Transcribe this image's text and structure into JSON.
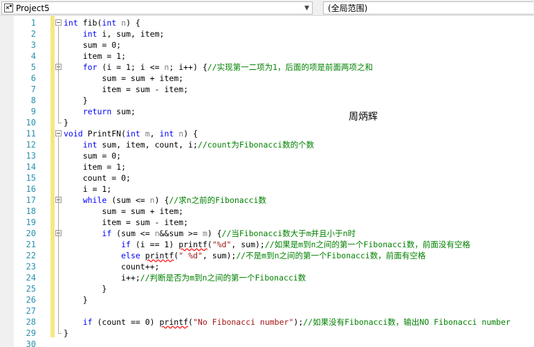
{
  "navbar": {
    "project": "Project5",
    "scope": "(全局范围)"
  },
  "author_name": "周炳辉",
  "editor": {
    "lines": [
      {
        "n": "1",
        "fold": true,
        "spans": [
          {
            "t": "int",
            "c": "kw"
          },
          {
            "t": " fib("
          },
          {
            "t": "int",
            "c": "kw"
          },
          {
            "t": " "
          },
          {
            "t": "n",
            "c": "pm"
          },
          {
            "t": ") {"
          }
        ]
      },
      {
        "n": "2",
        "spans": [
          {
            "t": "    "
          },
          {
            "t": "int",
            "c": "kw"
          },
          {
            "t": " i, sum, item;"
          }
        ]
      },
      {
        "n": "3",
        "spans": [
          {
            "t": "    sum = 0;"
          }
        ]
      },
      {
        "n": "4",
        "spans": [
          {
            "t": "    item = 1;"
          }
        ]
      },
      {
        "n": "5",
        "fold": true,
        "spans": [
          {
            "t": "    "
          },
          {
            "t": "for",
            "c": "kw"
          },
          {
            "t": " (i = 1; i <= "
          },
          {
            "t": "n",
            "c": "pm"
          },
          {
            "t": "; i++) {"
          },
          {
            "t": "//实现第一二项为1，后面的项是前面两项之和",
            "c": "cm"
          }
        ]
      },
      {
        "n": "6",
        "spans": [
          {
            "t": "        sum = sum + item;"
          }
        ]
      },
      {
        "n": "7",
        "spans": [
          {
            "t": "        item = sum - item;"
          }
        ]
      },
      {
        "n": "8",
        "spans": [
          {
            "t": "    }"
          }
        ]
      },
      {
        "n": "9",
        "spans": [
          {
            "t": "    "
          },
          {
            "t": "return",
            "c": "kw"
          },
          {
            "t": " sum;"
          }
        ]
      },
      {
        "n": "10",
        "spans": [
          {
            "t": "}"
          }
        ]
      },
      {
        "n": "11",
        "fold": true,
        "spans": [
          {
            "t": "void",
            "c": "kw"
          },
          {
            "t": " PrintFN("
          },
          {
            "t": "int",
            "c": "kw"
          },
          {
            "t": " "
          },
          {
            "t": "m",
            "c": "pm"
          },
          {
            "t": ", "
          },
          {
            "t": "int",
            "c": "kw"
          },
          {
            "t": " "
          },
          {
            "t": "n",
            "c": "pm"
          },
          {
            "t": ") {"
          }
        ]
      },
      {
        "n": "12",
        "spans": [
          {
            "t": "    "
          },
          {
            "t": "int",
            "c": "kw"
          },
          {
            "t": " sum, item, count, i;"
          },
          {
            "t": "//count为Fibonacci数的个数",
            "c": "cm"
          }
        ]
      },
      {
        "n": "13",
        "spans": [
          {
            "t": "    sum = 0;"
          }
        ]
      },
      {
        "n": "14",
        "spans": [
          {
            "t": "    item = 1;"
          }
        ]
      },
      {
        "n": "15",
        "spans": [
          {
            "t": "    count = 0;"
          }
        ]
      },
      {
        "n": "16",
        "spans": [
          {
            "t": "    i = 1;"
          }
        ]
      },
      {
        "n": "17",
        "fold": true,
        "spans": [
          {
            "t": "    "
          },
          {
            "t": "while",
            "c": "kw"
          },
          {
            "t": " (sum <= "
          },
          {
            "t": "n",
            "c": "pm"
          },
          {
            "t": ") {"
          },
          {
            "t": "//求n之前的Fibonacci数",
            "c": "cm"
          }
        ]
      },
      {
        "n": "18",
        "spans": [
          {
            "t": "        sum = sum + item;"
          }
        ]
      },
      {
        "n": "19",
        "spans": [
          {
            "t": "        item = sum - item;"
          }
        ]
      },
      {
        "n": "20",
        "fold": true,
        "spans": [
          {
            "t": "        "
          },
          {
            "t": "if",
            "c": "kw"
          },
          {
            "t": " (sum <= "
          },
          {
            "t": "n",
            "c": "pm"
          },
          {
            "t": "&&sum >= "
          },
          {
            "t": "m",
            "c": "pm"
          },
          {
            "t": ") {"
          },
          {
            "t": "//当Fibonacci数大于m并且小于n时",
            "c": "cm"
          }
        ]
      },
      {
        "n": "21",
        "spans": [
          {
            "t": "            "
          },
          {
            "t": "if",
            "c": "kw"
          },
          {
            "t": " (i == 1) "
          },
          {
            "t": "printf",
            "c": "err"
          },
          {
            "t": "("
          },
          {
            "t": "\"%d\"",
            "c": "st"
          },
          {
            "t": ", sum);"
          },
          {
            "t": "//如果是m到n之间的第一个Fibonacci数，前面没有空格",
            "c": "cm"
          }
        ]
      },
      {
        "n": "22",
        "spans": [
          {
            "t": "            "
          },
          {
            "t": "else",
            "c": "kw"
          },
          {
            "t": " "
          },
          {
            "t": "printf",
            "c": "err"
          },
          {
            "t": "("
          },
          {
            "t": "\" %d\"",
            "c": "st"
          },
          {
            "t": ", sum);"
          },
          {
            "t": "//不是m到n之间的第一个Fibonacci数，前面有空格",
            "c": "cm"
          }
        ]
      },
      {
        "n": "23",
        "spans": [
          {
            "t": "            count++;"
          }
        ]
      },
      {
        "n": "24",
        "spans": [
          {
            "t": "            i++;"
          },
          {
            "t": "//判断是否为m到n之间的第一个Fibonacci数",
            "c": "cm"
          }
        ]
      },
      {
        "n": "25",
        "spans": [
          {
            "t": "        }"
          }
        ]
      },
      {
        "n": "26",
        "spans": [
          {
            "t": "    }"
          }
        ]
      },
      {
        "n": "27",
        "spans": [
          {
            "t": ""
          }
        ]
      },
      {
        "n": "28",
        "spans": [
          {
            "t": "    "
          },
          {
            "t": "if",
            "c": "kw"
          },
          {
            "t": " (count == 0) "
          },
          {
            "t": "printf",
            "c": "err"
          },
          {
            "t": "("
          },
          {
            "t": "\"No Fibonacci number\"",
            "c": "st"
          },
          {
            "t": ");"
          },
          {
            "t": "//如果没有Fibonacci数，输出NO Fibonacci number",
            "c": "cm"
          }
        ]
      },
      {
        "n": "29",
        "spans": [
          {
            "t": "}"
          }
        ]
      },
      {
        "n": "30",
        "spans": [
          {
            "t": ""
          }
        ]
      }
    ]
  }
}
